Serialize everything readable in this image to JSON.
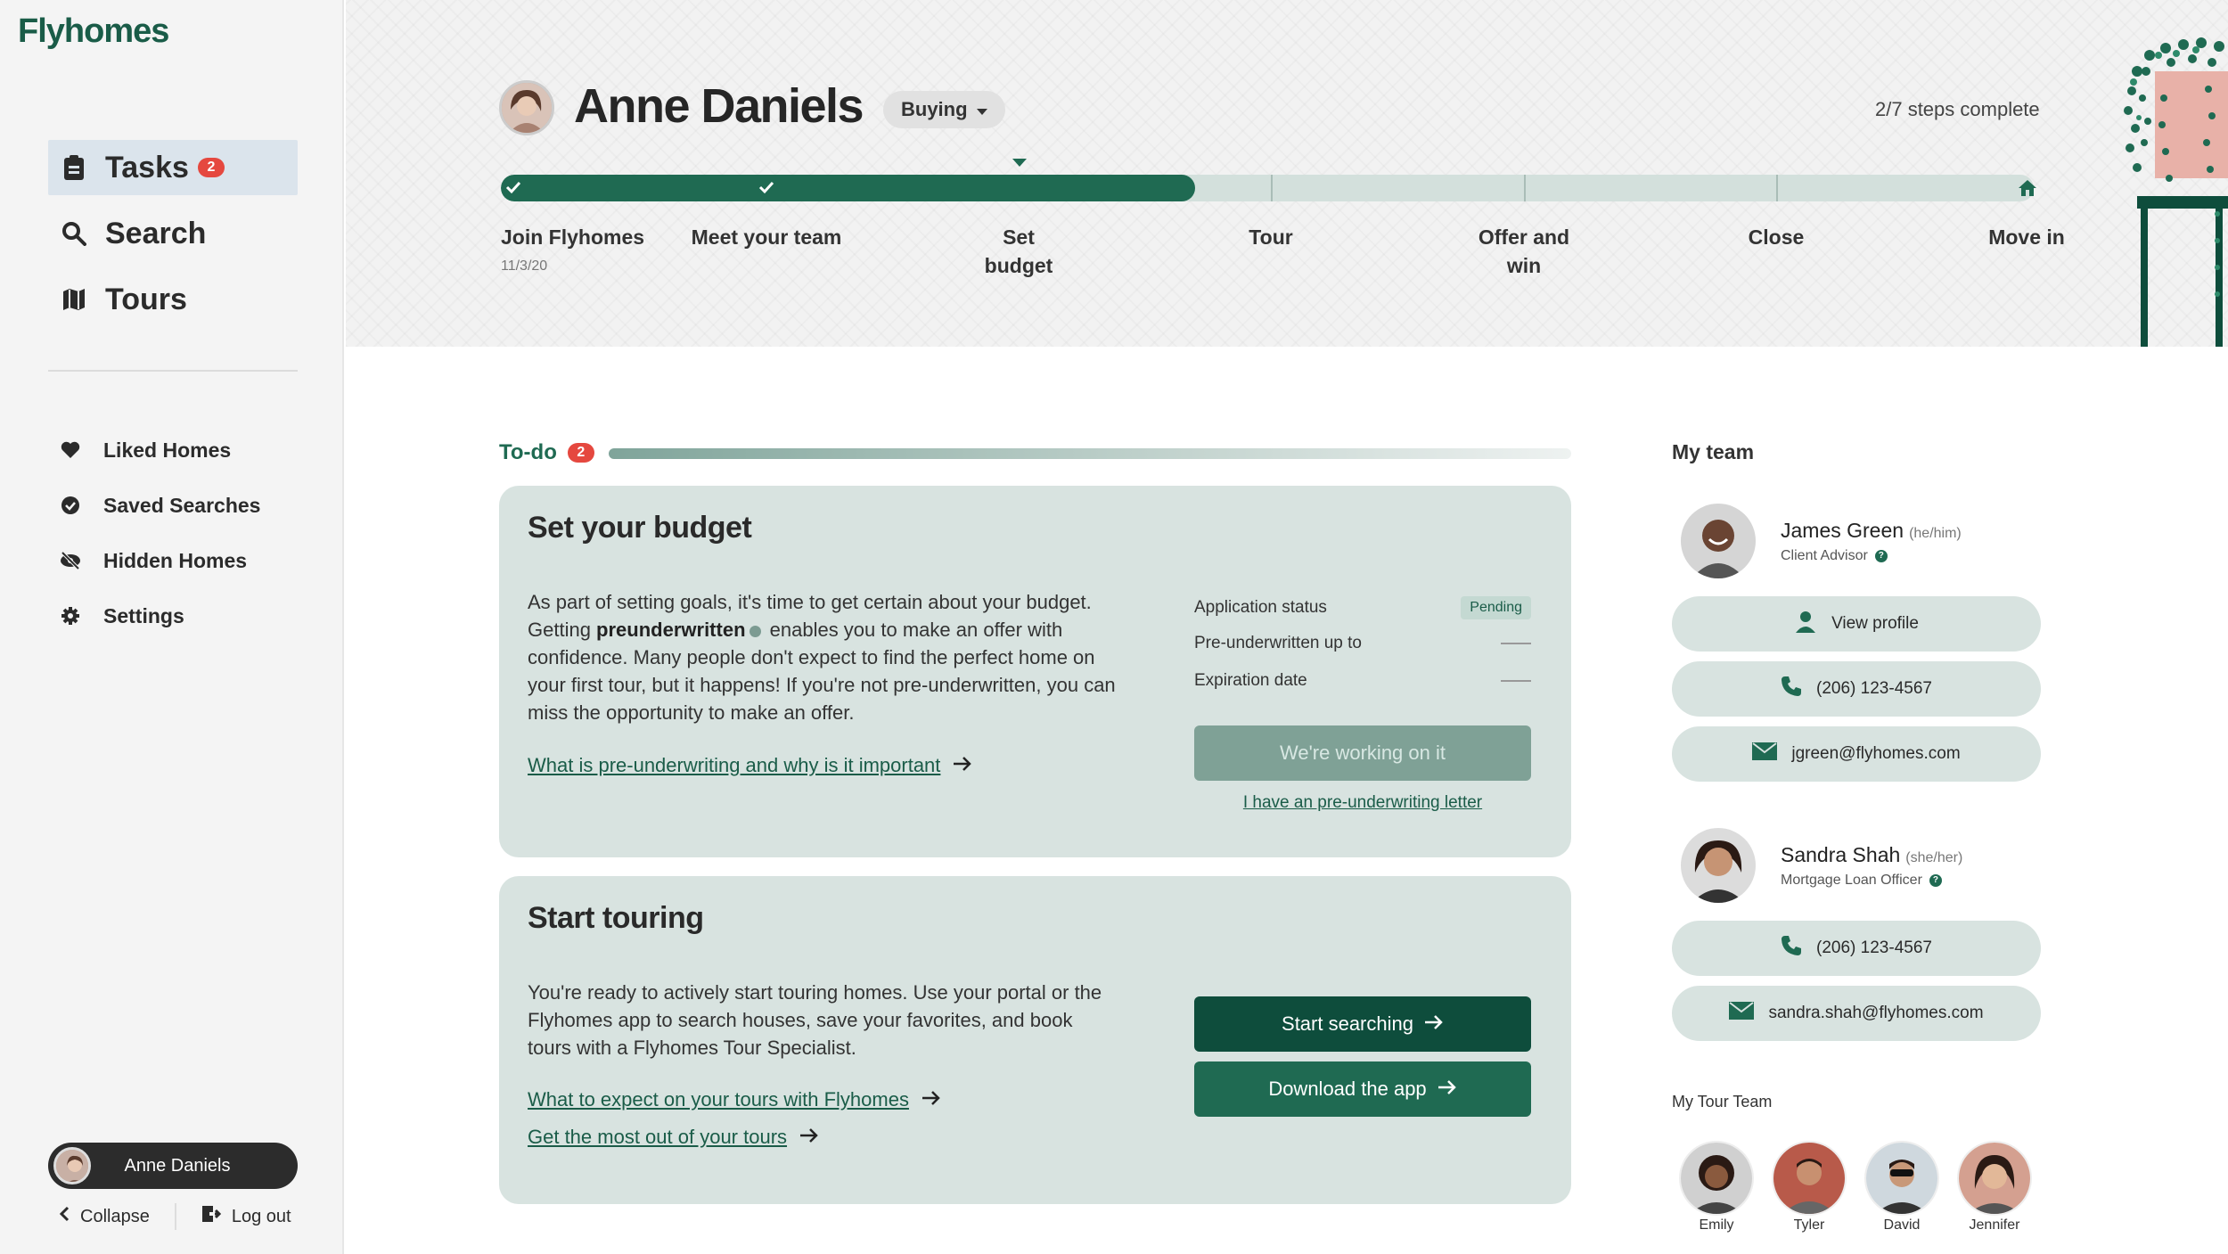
{
  "app": {
    "brand": "Flyhomes"
  },
  "sidebar": {
    "main_items": [
      {
        "label": "Tasks",
        "badge": "2",
        "active": true
      },
      {
        "label": "Search"
      },
      {
        "label": "Tours"
      }
    ],
    "secondary_items": [
      {
        "label": "Liked Homes"
      },
      {
        "label": "Saved Searches"
      },
      {
        "label": "Hidden Homes"
      },
      {
        "label": "Settings"
      }
    ],
    "user_name": "Anne Daniels",
    "collapse_label": "Collapse",
    "logout_label": "Log out"
  },
  "hero": {
    "name": "Anne Daniels",
    "role": "Buying",
    "steps_complete": "2/7 steps complete",
    "progress_fraction": 0.286,
    "steps": [
      {
        "label": "Join Flyhomes",
        "date": "11/3/20",
        "done": true
      },
      {
        "label": "Meet your team",
        "done": true
      },
      {
        "label": "Set budget",
        "current": true
      },
      {
        "label": "Tour"
      },
      {
        "label": "Offer and win"
      },
      {
        "label": "Close"
      },
      {
        "label": "Move in"
      }
    ]
  },
  "todo": {
    "label": "To-do",
    "count": "2",
    "budget_card": {
      "title": "Set your budget",
      "body_1": "As part of setting goals, it's time to get certain about your budget. Getting ",
      "body_bold": "preunderwritten",
      "body_2": " enables you to make an offer with confidence. Many people don't expect to find the perfect home on your first tour, but it happens! If you're not pre-underwritten, you can miss the opportunity to make an offer.",
      "link": "What is pre-underwriting and why is it important",
      "status_label": "Application status",
      "status_value": "Pending",
      "preunderwritten_label": "Pre-underwritten up to",
      "expiration_label": "Expiration date",
      "button": "We're working on it",
      "sublink": "I have an pre-underwriting letter"
    },
    "tour_card": {
      "title": "Start touring",
      "body": "You're ready to actively start touring homes. Use your portal or the Flyhomes app to search houses, save your favorites, and book tours with a Flyhomes Tour Specialist.",
      "link_1": "What to expect on your tours with Flyhomes",
      "link_2": "Get the most out of your tours",
      "button_1": "Start searching",
      "button_2": "Download the app"
    }
  },
  "team": {
    "title": "My team",
    "members": [
      {
        "name": "James Green",
        "pronouns": "(he/him)",
        "role": "Client Advisor",
        "view_profile": "View profile",
        "phone": "(206) 123-4567",
        "email": "jgreen@flyhomes.com"
      },
      {
        "name": "Sandra Shah",
        "pronouns": "(she/her)",
        "role": "Mortgage Loan Officer",
        "phone": "(206) 123-4567",
        "email": "sandra.shah@flyhomes.com"
      }
    ],
    "tour_team_title": "My Tour Team",
    "tour_team": [
      "Emily",
      "Tyler",
      "David",
      "Jennifer"
    ]
  },
  "colors": {
    "brand": "#1a5c48",
    "accent": "#1f6a52",
    "badge": "#e5483f",
    "card_bg": "#d8e3e0"
  }
}
